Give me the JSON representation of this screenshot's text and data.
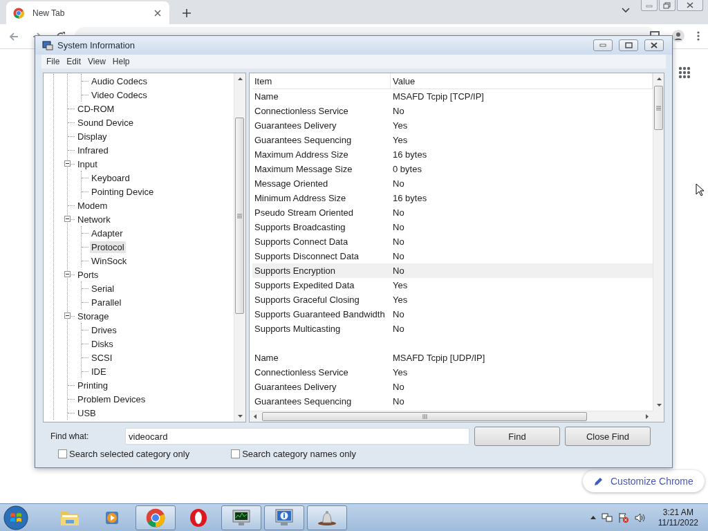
{
  "browser": {
    "tab": {
      "title": "New Tab"
    },
    "customize_button": "Customize Chrome"
  },
  "window": {
    "title": "System Information",
    "menu": [
      "File",
      "Edit",
      "View",
      "Help"
    ],
    "tree": [
      {
        "children": [
          {
            "children": [
              {
                "label": "Audio Codecs",
                "selected": false
              },
              {
                "label": "Video Codecs",
                "selected": false
              }
            ]
          },
          {
            "label": "CD-ROM",
            "selected": false
          },
          {
            "label": "Sound Device",
            "selected": false
          },
          {
            "label": "Display",
            "selected": false
          },
          {
            "label": "Infrared",
            "selected": false
          },
          {
            "label": "Input",
            "selected": false,
            "expanded": true,
            "children": [
              {
                "label": "Keyboard",
                "selected": false
              },
              {
                "label": "Pointing Device",
                "selected": false
              }
            ]
          },
          {
            "label": "Modem",
            "selected": false
          },
          {
            "label": "Network",
            "selected": false,
            "expanded": true,
            "children": [
              {
                "label": "Adapter",
                "selected": false
              },
              {
                "label": "Protocol",
                "selected": true
              },
              {
                "label": "WinSock",
                "selected": false
              }
            ]
          },
          {
            "label": "Ports",
            "selected": false,
            "expanded": true,
            "children": [
              {
                "label": "Serial",
                "selected": false
              },
              {
                "label": "Parallel",
                "selected": false
              }
            ]
          },
          {
            "label": "Storage",
            "selected": false,
            "expanded": true,
            "children": [
              {
                "label": "Drives",
                "selected": false
              },
              {
                "label": "Disks",
                "selected": false
              },
              {
                "label": "SCSI",
                "selected": false
              },
              {
                "label": "IDE",
                "selected": false
              }
            ]
          },
          {
            "label": "Printing",
            "selected": false
          },
          {
            "label": "Problem Devices",
            "selected": false
          },
          {
            "label": "USB",
            "selected": false
          }
        ]
      }
    ],
    "table": {
      "columns": [
        "Item",
        "Value"
      ],
      "groups": [
        {
          "rows": [
            {
              "item": "Name",
              "value": "MSAFD Tcpip [TCP/IP]",
              "selected": false
            },
            {
              "item": "Connectionless Service",
              "value": "No",
              "selected": false
            },
            {
              "item": "Guarantees Delivery",
              "value": "Yes",
              "selected": false
            },
            {
              "item": "Guarantees Sequencing",
              "value": "Yes",
              "selected": false
            },
            {
              "item": "Maximum Address Size",
              "value": "16 bytes",
              "selected": false
            },
            {
              "item": "Maximum Message Size",
              "value": "0 bytes",
              "selected": false
            },
            {
              "item": "Message Oriented",
              "value": "No",
              "selected": false
            },
            {
              "item": "Minimum Address Size",
              "value": "16 bytes",
              "selected": false
            },
            {
              "item": "Pseudo Stream Oriented",
              "value": "No",
              "selected": false
            },
            {
              "item": "Supports Broadcasting",
              "value": "No",
              "selected": false
            },
            {
              "item": "Supports Connect Data",
              "value": "No",
              "selected": false
            },
            {
              "item": "Supports Disconnect Data",
              "value": "No",
              "selected": false
            },
            {
              "item": "Supports Encryption",
              "value": "No",
              "selected": true
            },
            {
              "item": "Supports Expedited Data",
              "value": "Yes",
              "selected": false
            },
            {
              "item": "Supports Graceful Closing",
              "value": "Yes",
              "selected": false
            },
            {
              "item": "Supports Guaranteed Bandwidth",
              "value": "No",
              "selected": false
            },
            {
              "item": "Supports Multicasting",
              "value": "No",
              "selected": false
            }
          ]
        },
        {
          "rows": [
            {
              "item": "Name",
              "value": "MSAFD Tcpip [UDP/IP]",
              "selected": false
            },
            {
              "item": "Connectionless Service",
              "value": "Yes",
              "selected": false
            },
            {
              "item": "Guarantees Delivery",
              "value": "No",
              "selected": false
            },
            {
              "item": "Guarantees Sequencing",
              "value": "No",
              "selected": false
            }
          ]
        }
      ]
    },
    "find": {
      "label": "Find what:",
      "value": "videocard",
      "buttons": [
        "Find",
        "Close Find"
      ],
      "checkboxes": [
        {
          "label": "Search selected category only",
          "checked": false
        },
        {
          "label": "Search category names only",
          "checked": false
        }
      ]
    }
  },
  "taskbar": {
    "apps": [
      {
        "kind": "folder",
        "active": false
      },
      {
        "kind": "media",
        "active": false
      },
      {
        "kind": "chrome",
        "active": true
      },
      {
        "kind": "opera",
        "active": false
      },
      {
        "kind": "monitor",
        "active": true
      },
      {
        "kind": "info",
        "active": true
      },
      {
        "kind": "bell",
        "active": true
      }
    ],
    "clock": {
      "time": "3:21 AM",
      "date": "11/11/2022"
    }
  }
}
